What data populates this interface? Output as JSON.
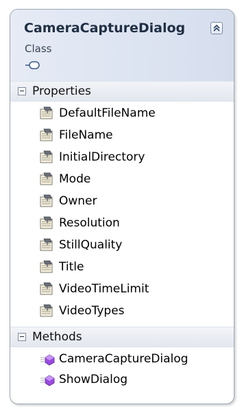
{
  "class_box": {
    "name": "CameraCaptureDialog",
    "kind": "Class"
  },
  "sections": [
    {
      "label": "Properties",
      "members": [
        "DefaultFileName",
        "FileName",
        "InitialDirectory",
        "Mode",
        "Owner",
        "Resolution",
        "StillQuality",
        "Title",
        "VideoTimeLimit",
        "VideoTypes"
      ]
    },
    {
      "label": "Methods",
      "members": [
        "CameraCaptureDialog",
        "ShowDialog"
      ]
    }
  ],
  "icons": {
    "class_icon": "class-inheritance-icon",
    "collapse_icon": "double-chevron-up-icon",
    "property_icon": "property-icon",
    "method_icon": "method-icon"
  },
  "colors": {
    "header_gradient_start": "#e6ebf5",
    "header_gradient_end": "#d6deee",
    "border": "#9da6b2",
    "method_purple": "#8a3fd1"
  }
}
